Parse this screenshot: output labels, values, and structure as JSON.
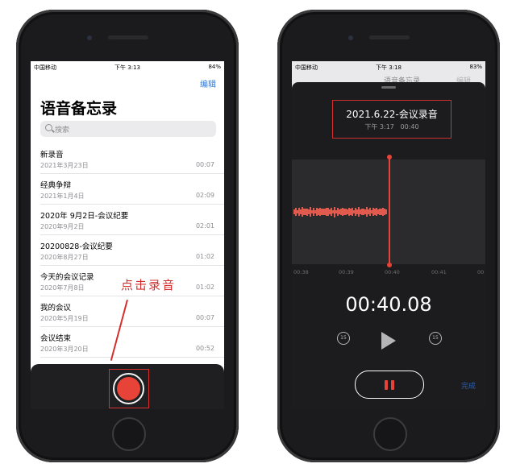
{
  "left_phone": {
    "status": {
      "carrier": "中国移动",
      "time": "下午 3:13",
      "battery": "84%"
    },
    "edit_label": "编辑",
    "title": "语音备忘录",
    "search_placeholder": "搜索",
    "recordings": [
      {
        "name": "新录音",
        "date": "2021年3月23日",
        "duration": "00:07"
      },
      {
        "name": "经典争辩",
        "date": "2021年1月4日",
        "duration": "02:09"
      },
      {
        "name": "2020年 9月2日-会议纪要",
        "date": "2020年9月2日",
        "duration": "02:01"
      },
      {
        "name": "20200828-会议纪要",
        "date": "2020年8月27日",
        "duration": "01:02"
      },
      {
        "name": "今天的会议记录",
        "date": "2020年7月8日",
        "duration": "01:02"
      },
      {
        "name": "我的会议",
        "date": "2020年5月19日",
        "duration": "00:07"
      },
      {
        "name": "会议结束",
        "date": "2020年3月20日",
        "duration": "00:52"
      }
    ],
    "annotation": "点击录音",
    "record_button_color": "#e84338"
  },
  "right_phone": {
    "status": {
      "carrier": "中国移动",
      "time": "下午 3:18",
      "battery": "83%"
    },
    "behind_title": "语音备忘录",
    "behind_edit": "编辑",
    "memo_title": "2021.6.22-会议录音",
    "memo_time": "下午 3:17",
    "memo_elapsed": "00:40",
    "timeline_ticks": [
      "00:38",
      "00:39",
      "00:40",
      "00:41",
      "00"
    ],
    "timer": "00:40.08",
    "skip_back_label": "15",
    "skip_forward_label": "15",
    "done_label": "完成",
    "accent_color": "#e84338"
  }
}
